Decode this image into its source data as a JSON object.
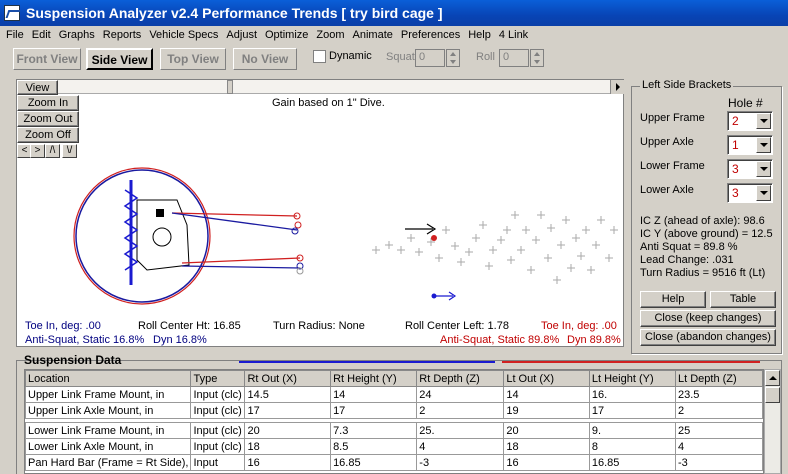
{
  "window": {
    "title": "Suspension Analyzer v2.4   Performance Trends   [ try bird cage ]"
  },
  "menu": [
    "File",
    "Edit",
    "Graphs",
    "Reports",
    "Vehicle Specs",
    "Adjust",
    "Optimize",
    "Zoom",
    "Animate",
    "Preferences",
    "Help",
    "4 Link"
  ],
  "toolbar": {
    "tabs": [
      "Front View",
      "Side View",
      "Top View",
      "No View"
    ],
    "dynamic_label": "Dynamic",
    "squat_label": "Squat",
    "squat_value": "0",
    "roll_label": "Roll",
    "roll_value": "0"
  },
  "view": {
    "view_button": "View",
    "zoom_in": "Zoom In",
    "zoom_out": "Zoom Out",
    "zoom_off": "Zoom Off",
    "arrow_buttons": [
      "<",
      ">",
      "/\\",
      "\\/"
    ],
    "gain_text": "Gain based on 1\" Dive.",
    "toe_in_left": "Toe In, deg: .00",
    "anti_squat_left": "Anti-Squat, Static 16.8%",
    "dyn_left": "Dyn 16.8%",
    "roll_center_ht": "Roll Center Ht: 16.85",
    "turn_radius": "Turn Radius: None",
    "roll_center_left": "Roll Center Left: 1.78",
    "toe_in_right": "Toe In, deg: .00",
    "anti_squat_right": "Anti-Squat, Static 89.8%",
    "dyn_right": "Dyn 89.8%"
  },
  "brackets": {
    "title": "Left Side Brackets",
    "hole_header": "Hole #",
    "rows": [
      {
        "label": "Upper Frame",
        "value": "2"
      },
      {
        "label": "Upper Axle",
        "value": "1"
      },
      {
        "label": "Lower  Frame",
        "value": "3"
      },
      {
        "label": "Lower Axle",
        "value": "3"
      }
    ],
    "info": [
      "IC Z (ahead of axle): 98.6",
      "IC Y (above ground) = 12.5",
      "Anti Squat = 89.8 %",
      "Lead Change: .031",
      "Turn Radius = 9516 ft (Lt)"
    ],
    "help_button": "Help",
    "table_button": "Table",
    "close_keep": "Close (keep changes)",
    "close_abandon": "Close (abandon  changes)"
  },
  "suspension_data": {
    "title": "Suspension Data",
    "columns": [
      "Location",
      "Type",
      "Rt Out (X)",
      "Rt Height (Y)",
      "Rt Depth (Z)",
      "Lt Out (X)",
      "Lt Height (Y)",
      "Lt Depth (Z)"
    ],
    "rows": [
      [
        "Upper Link Frame Mount, in",
        "Input (clc)",
        "14.5",
        "14",
        "24",
        "14",
        "16.",
        "23.5"
      ],
      [
        "Upper Link Axle Mount, in",
        "Input (clc)",
        "17",
        "17",
        "2",
        "19",
        "17",
        "2"
      ],
      [
        "Lower Link Frame Mount, in",
        "Input (clc)",
        "20",
        "7.3",
        "25.",
        "20",
        "9.",
        "25"
      ],
      [
        "Lower Link Axle Mount, in",
        "Input (clc)",
        "18",
        "8.5",
        "4",
        "18",
        "8",
        "4"
      ],
      [
        "Pan Hard Bar (Frame = Rt Side),",
        "Input",
        "16",
        "16.85",
        "-3",
        "16",
        "16.85",
        "-3"
      ]
    ]
  },
  "colors": {
    "title_bar": "#0a52c8",
    "red_value": "#c00000",
    "blue_text": "#000080",
    "red_text": "#c00000"
  }
}
